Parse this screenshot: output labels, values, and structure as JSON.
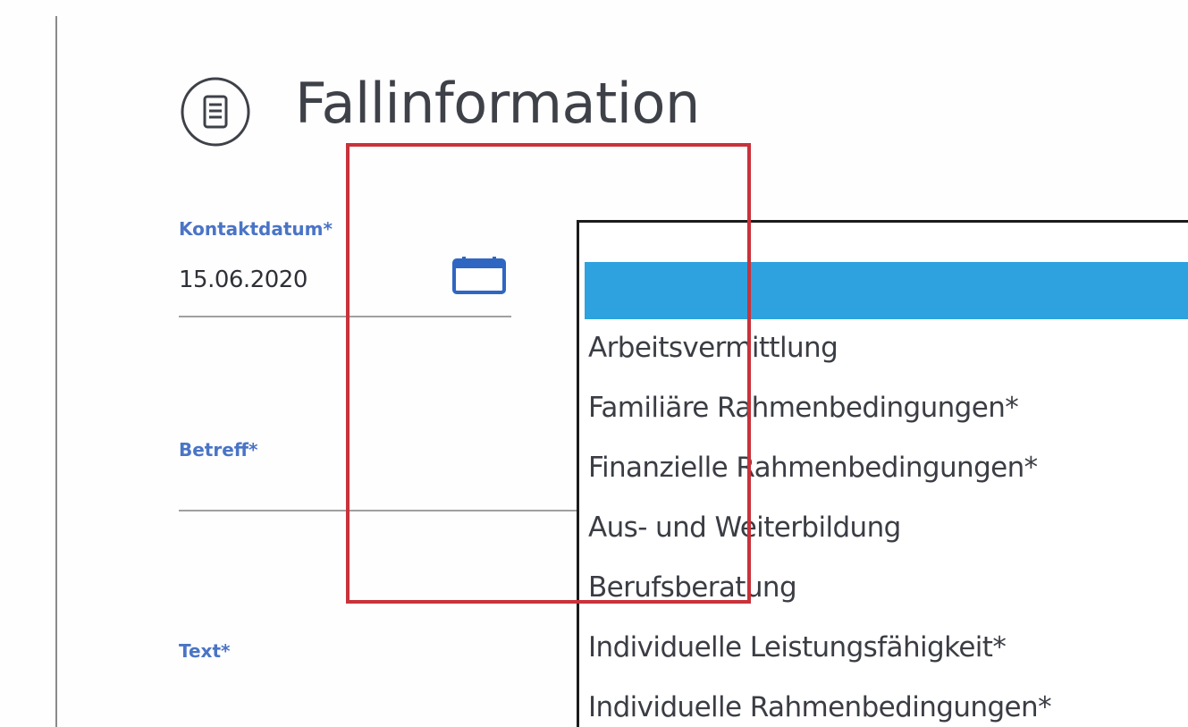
{
  "section": {
    "title": "Fallinformation",
    "icon": "document-icon"
  },
  "form": {
    "contact_date": {
      "label": "Kontaktdatum*",
      "value": "15.06.2020",
      "icon": "calendar-icon"
    },
    "subject": {
      "label": "Betreff*"
    },
    "text": {
      "label": "Text*"
    }
  },
  "dropdown": {
    "selected_value": "",
    "options": [
      "Arbeitsvermittlung",
      "Familiäre Rahmenbedingungen*",
      "Finanzielle Rahmenbedingungen*",
      "Aus- und Weiterbildung",
      "Berufsberatung",
      "Individuelle Leistungsfähigkeit*",
      "Individuelle Rahmenbedingungen*"
    ]
  },
  "colors": {
    "label": "#4a74c6",
    "selected": "#2da2de",
    "highlight": "#c8323a",
    "text": "#3b3d44"
  }
}
